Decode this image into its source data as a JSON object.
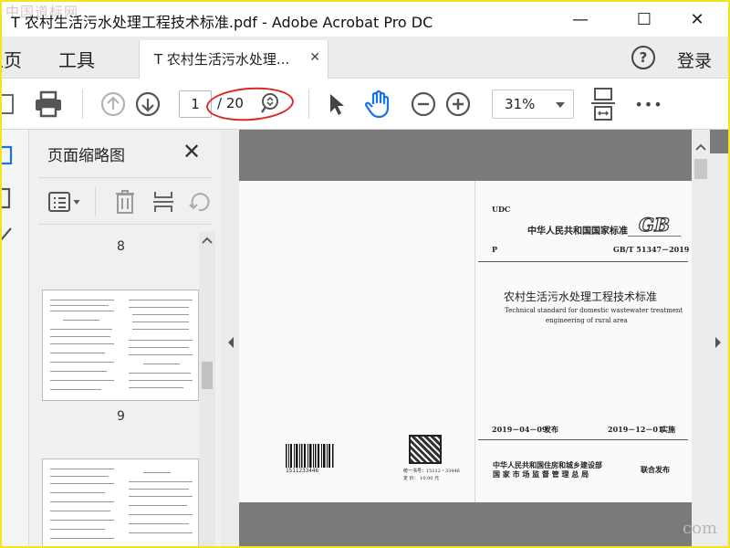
{
  "watermark": {
    "top_left": "中国道标网",
    "bottom_right": "com"
  },
  "window": {
    "title": "T 农村生活污水处理工程技术标准.pdf - Adobe Acrobat Pro DC",
    "minimize_glyph": "—",
    "maximize_glyph": "☐",
    "close_glyph": "✕"
  },
  "tabbar": {
    "home_label": "主页",
    "tools_label": "工具",
    "doc_tab_label": "T 农村生活污水处理...",
    "doc_tab_close": "✕",
    "help_glyph": "?",
    "login_label": "登录"
  },
  "toolbar": {
    "current_page": "1",
    "total_pages": "/ 20",
    "zoom": "31%",
    "more_glyph": "•••"
  },
  "thumb_panel": {
    "title": "页面缩略图",
    "close_glyph": "✕",
    "labels": [
      "8",
      "9"
    ]
  },
  "cover": {
    "udc": "UDC",
    "national_standard": "中华人民共和国国家标准",
    "gb_logo": "GB",
    "p_label": "P",
    "code": "GB/T 51347－2019",
    "title_cn": "农村生活污水处理工程技术标准",
    "title_en_1": "Technical standard for domestic wastewater treatment",
    "title_en_2": "engineering of rural area",
    "issue_date": "2019－04－09",
    "issue_label": "发布",
    "impl_date": "2019－12－01",
    "impl_label": "实施",
    "issuer_1": "中华人民共和国住房和城乡建设部",
    "issuer_2": "国 家 市 场 监 督 管 理 总 局",
    "joint_issue": "联合发布",
    "barcode_number": "1511233446",
    "serial_line_1": "统一书号：15112・33446",
    "serial_line_2": "定    价：  10.00   元"
  },
  "colors": {
    "accent": "#1473e6",
    "annotation_red": "#d92828"
  }
}
